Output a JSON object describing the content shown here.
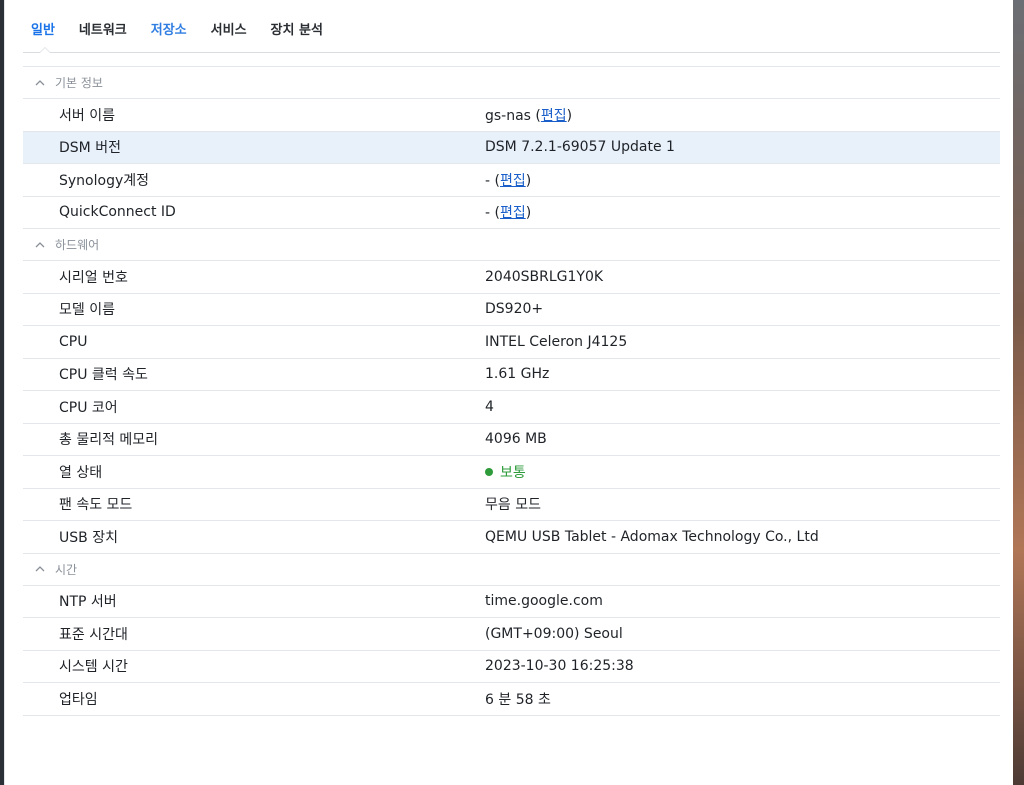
{
  "tabs": [
    {
      "label": "일반"
    },
    {
      "label": "네트워크"
    },
    {
      "label": "저장소"
    },
    {
      "label": "서비스"
    },
    {
      "label": "장치 분석"
    }
  ],
  "colors": {
    "active_tab": "#1a73e8",
    "link": "#1a5fc9",
    "status_ok": "#2e9b3a",
    "selected_row": "#e8f0fa"
  },
  "groups": {
    "basic": {
      "title": "기본 정보",
      "server_name": {
        "label": "서버 이름",
        "value": "gs-nas",
        "edit_open": " (",
        "edit": "편집",
        "edit_close": ")"
      },
      "dsm_version": {
        "label": "DSM 버전",
        "value": "DSM 7.2.1-69057 Update 1"
      },
      "synology_account": {
        "label": "Synology계정",
        "value": "-",
        "edit_open": " (",
        "edit": "편집",
        "edit_close": ")"
      },
      "quickconnect": {
        "label": "QuickConnect ID",
        "value": "-",
        "edit_open": " (",
        "edit": "편집",
        "edit_close": ")"
      }
    },
    "hardware": {
      "title": "하드웨어",
      "serial": {
        "label": "시리얼 번호",
        "value": "2040SBRLG1Y0K"
      },
      "model": {
        "label": "모델 이름",
        "value": "DS920+"
      },
      "cpu": {
        "label": "CPU",
        "value": "INTEL Celeron J4125"
      },
      "cpu_clock": {
        "label": "CPU 클럭 속도",
        "value": "1.61 GHz"
      },
      "cpu_cores": {
        "label": "CPU 코어",
        "value": "4"
      },
      "memory": {
        "label": "총 물리적 메모리",
        "value": "4096 MB"
      },
      "thermal": {
        "label": "열 상태",
        "value": "보통",
        "icon": "status-dot-icon"
      },
      "fan": {
        "label": "팬 속도 모드",
        "value": "무음 모드"
      },
      "usb": {
        "label": "USB 장치",
        "value": "QEMU USB Tablet - Adomax Technology Co., Ltd"
      }
    },
    "time": {
      "title": "시간",
      "ntp": {
        "label": "NTP 서버",
        "value": "time.google.com"
      },
      "timezone": {
        "label": "표준 시간대",
        "value": "(GMT+09:00) Seoul"
      },
      "system_time": {
        "label": "시스템 시간",
        "value": "2023-10-30 16:25:38"
      },
      "uptime": {
        "label": "업타임",
        "value": "6 분 58 초"
      }
    }
  }
}
